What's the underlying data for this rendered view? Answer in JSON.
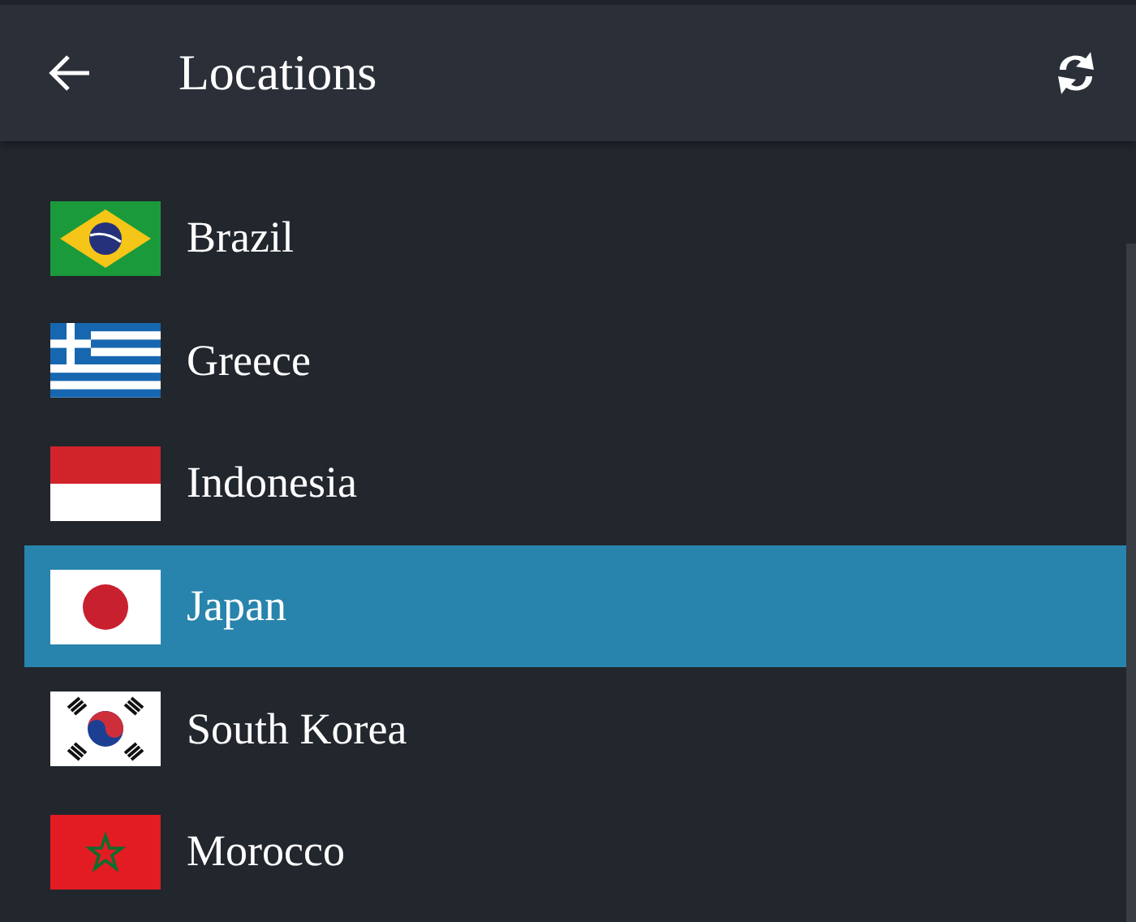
{
  "header": {
    "title": "Locations"
  },
  "locations": [
    {
      "name": "Brazil",
      "kind": "brazil",
      "selected": false
    },
    {
      "name": "Greece",
      "kind": "greece",
      "selected": false
    },
    {
      "name": "Indonesia",
      "kind": "indonesia",
      "selected": false
    },
    {
      "name": "Japan",
      "kind": "japan",
      "selected": true
    },
    {
      "name": "South Korea",
      "kind": "korea",
      "selected": false
    },
    {
      "name": "Morocco",
      "kind": "morocco",
      "selected": false
    }
  ]
}
